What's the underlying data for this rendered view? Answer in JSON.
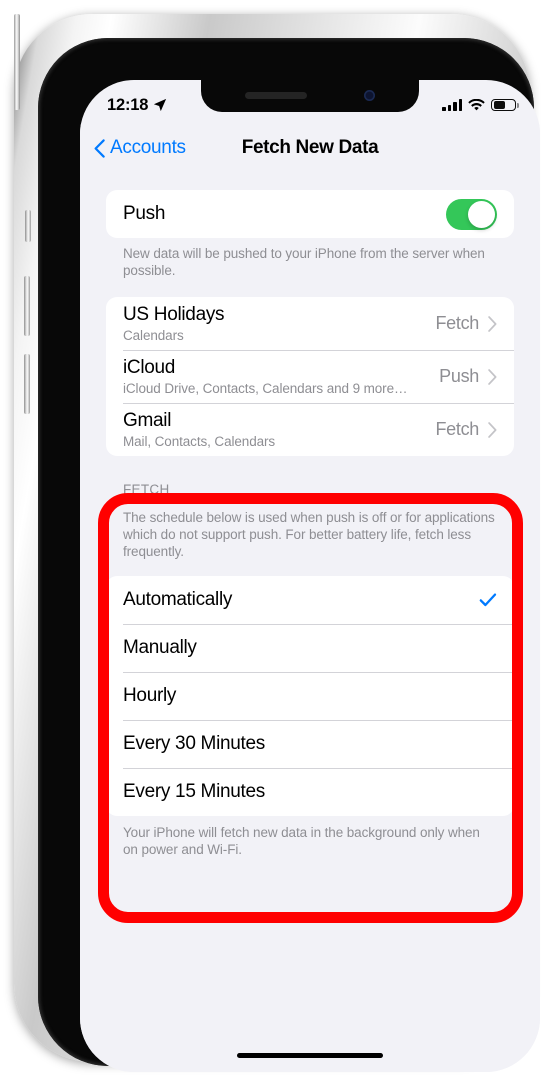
{
  "status_bar": {
    "time": "12:18",
    "location_icon": "location-arrow-icon",
    "cellular_icon": "signal-bars-icon",
    "wifi_icon": "wifi-icon",
    "battery_icon": "battery-icon",
    "battery_level_pct": 55
  },
  "nav": {
    "back_label": "Accounts",
    "back_icon": "chevron-left-icon",
    "title": "Fetch New Data"
  },
  "push": {
    "label": "Push",
    "enabled": true,
    "toggle_color": "#34C759",
    "footnote": "New data will be pushed to your iPhone from the server when possible."
  },
  "accounts": [
    {
      "title": "US Holidays",
      "subtitle": "Calendars",
      "value": "Fetch"
    },
    {
      "title": "iCloud",
      "subtitle": "iCloud Drive, Contacts, Calendars and 9 more…",
      "value": "Push"
    },
    {
      "title": "Gmail",
      "subtitle": "Mail, Contacts, Calendars",
      "value": "Fetch"
    }
  ],
  "fetch": {
    "header": "FETCH",
    "description": "The schedule below is used when push is off or for applications which do not support push. For better battery life, fetch less frequently.",
    "options": [
      {
        "label": "Automatically",
        "selected": true
      },
      {
        "label": "Manually",
        "selected": false
      },
      {
        "label": "Hourly",
        "selected": false
      },
      {
        "label": "Every 30 Minutes",
        "selected": false
      },
      {
        "label": "Every 15 Minutes",
        "selected": false
      }
    ],
    "footnote": "Your iPhone will fetch new data in the background only when on power and Wi-Fi.",
    "check_color": "#007AFF"
  },
  "annotation": {
    "shape": "rounded-rectangle",
    "color": "#FF0000"
  },
  "home_indicator": "home-indicator"
}
